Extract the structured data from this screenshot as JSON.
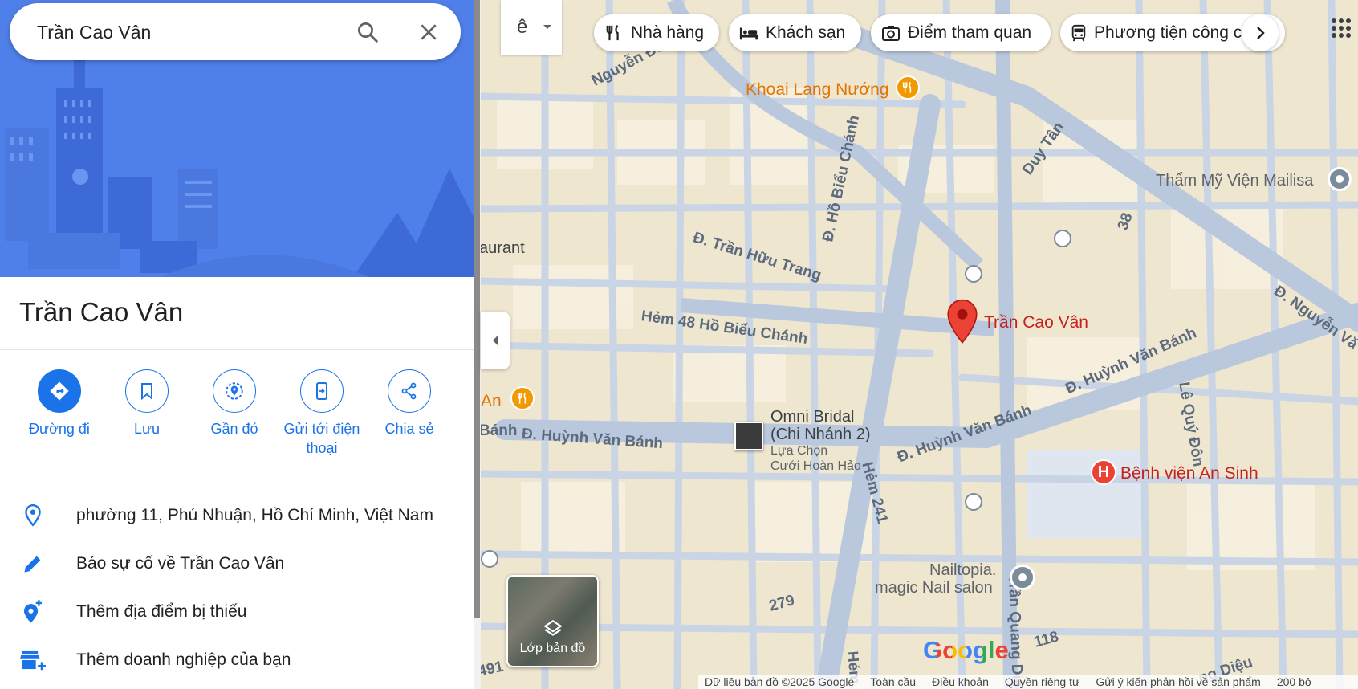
{
  "search": {
    "query": "Trần Cao Vân"
  },
  "place": {
    "title": "Trần Cao Vân"
  },
  "actions": [
    {
      "label": "Đường đi",
      "icon": "directions-icon"
    },
    {
      "label": "Lưu",
      "icon": "bookmark-icon"
    },
    {
      "label": "Gần đó",
      "icon": "nearby-icon"
    },
    {
      "label_line1": "Gửi tới điện",
      "label_line2": "thoại",
      "icon": "send-to-phone-icon"
    },
    {
      "label": "Chia sẻ",
      "icon": "share-icon"
    }
  ],
  "info": {
    "address": "phường 11, Phú Nhuận, Hồ Chí Minh, Việt Nam",
    "report": "Báo sự cố về Trần Cao Vân",
    "add_missing": "Thêm địa điểm bị thiếu",
    "add_business": "Thêm doanh nghiệp của bạn"
  },
  "map": {
    "lang_glyph": "ê",
    "chips": [
      "Nhà hàng",
      "Khách sạn",
      "Điểm tham quan",
      "Phương tiện công cộng"
    ],
    "labels": {
      "khoai": "Khoai Lang Nướng",
      "tham_my": "Thẩm Mỹ Viện Mailisa",
      "marker": "Trần Cao Vân",
      "omni_1": "Omni Bridal",
      "omni_2": "(Chi Nhánh 2)",
      "omni_3": "Lựa Chọn",
      "omni_4": "Cưới Hoàn Hảo",
      "benh_vien": "Bệnh viện An Sinh",
      "nailtopia_1": "Nailtopia.",
      "nailtopia_2": "magic Nail salon",
      "aurant": "aurant",
      "an": "An",
      "banh": "Bánh"
    },
    "streets": {
      "nguyen_dinh": "Nguyễn Đình",
      "ho_bieu_chanh": "Đ. Hồ Biểu Chánh",
      "tran_huu_trang": "Đ. Trần Hữu Trang",
      "hem48": "Hẻm 48 Hồ Biểu Chánh",
      "duy_tan": "Duy Tân",
      "huynh_van_banh_left": "Đ. Huỳnh Văn Bánh",
      "huynh_van_banh_mid": "Đ. Huỳnh Văn Bánh",
      "huynh_van_banh_right": "Đ. Huỳnh Văn Bánh",
      "nguyen_right": "Đ. Nguyễn Vă",
      "le_quy_don": "Lê Quý Đôn",
      "hem241": "Hẻm 241",
      "tran_quang_dieu": "Trần Quang Diệu",
      "n279": "279",
      "n118": "118",
      "n38": "38",
      "n491": "491",
      "hem_bottom": "Hẻm",
      "dieu_bottom": "ng Diệu"
    },
    "layers_label": "Lớp bản đồ",
    "google_logo": "Google",
    "footer": {
      "data": "Dữ liệu bản đồ ©2025 Google",
      "global": "Toàn cầu",
      "terms": "Điều khoản",
      "privacy": "Quyền riêng tư",
      "feedback": "Gửi ý kiến phản hồi về sản phẩm",
      "scale": "200 bộ"
    }
  },
  "colors": {
    "accent": "#1a73e8",
    "hero_bg": "#4f7fe8",
    "map_bg": "#efe6cf",
    "road": "#c7d3e3",
    "marker": "#ea4335"
  }
}
